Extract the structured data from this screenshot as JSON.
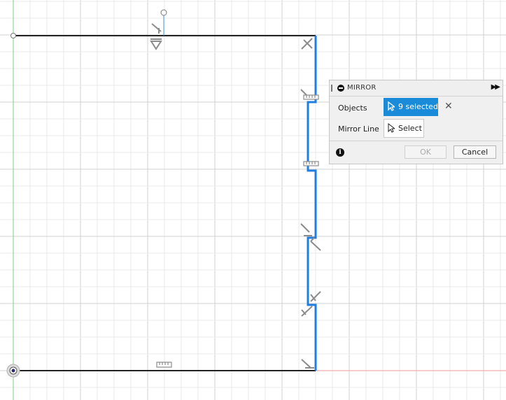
{
  "canvas": {
    "grid_color_minor": "#e8e8e8",
    "grid_color_major": "#d0d0d0",
    "axis_green": "#7ccf7c",
    "axis_red": "#f29a9a",
    "profile_color": "#222222",
    "selected_color": "#1f7ee0",
    "constraint_color": "#8c8c8c",
    "icons": [
      "perpendicular-constraint-icon",
      "horizontal-constraint-icon",
      "dimension-icon",
      "origin-point-icon"
    ]
  },
  "dialog": {
    "title": "MIRROR",
    "expand_icon": "fast-forward-icon",
    "objects_label": "Objects",
    "objects_value": "9 selected",
    "mirror_line_label": "Mirror Line",
    "mirror_line_value": "Select",
    "ok_label": "OK",
    "cancel_label": "Cancel",
    "accent": "#1a8bd9"
  }
}
